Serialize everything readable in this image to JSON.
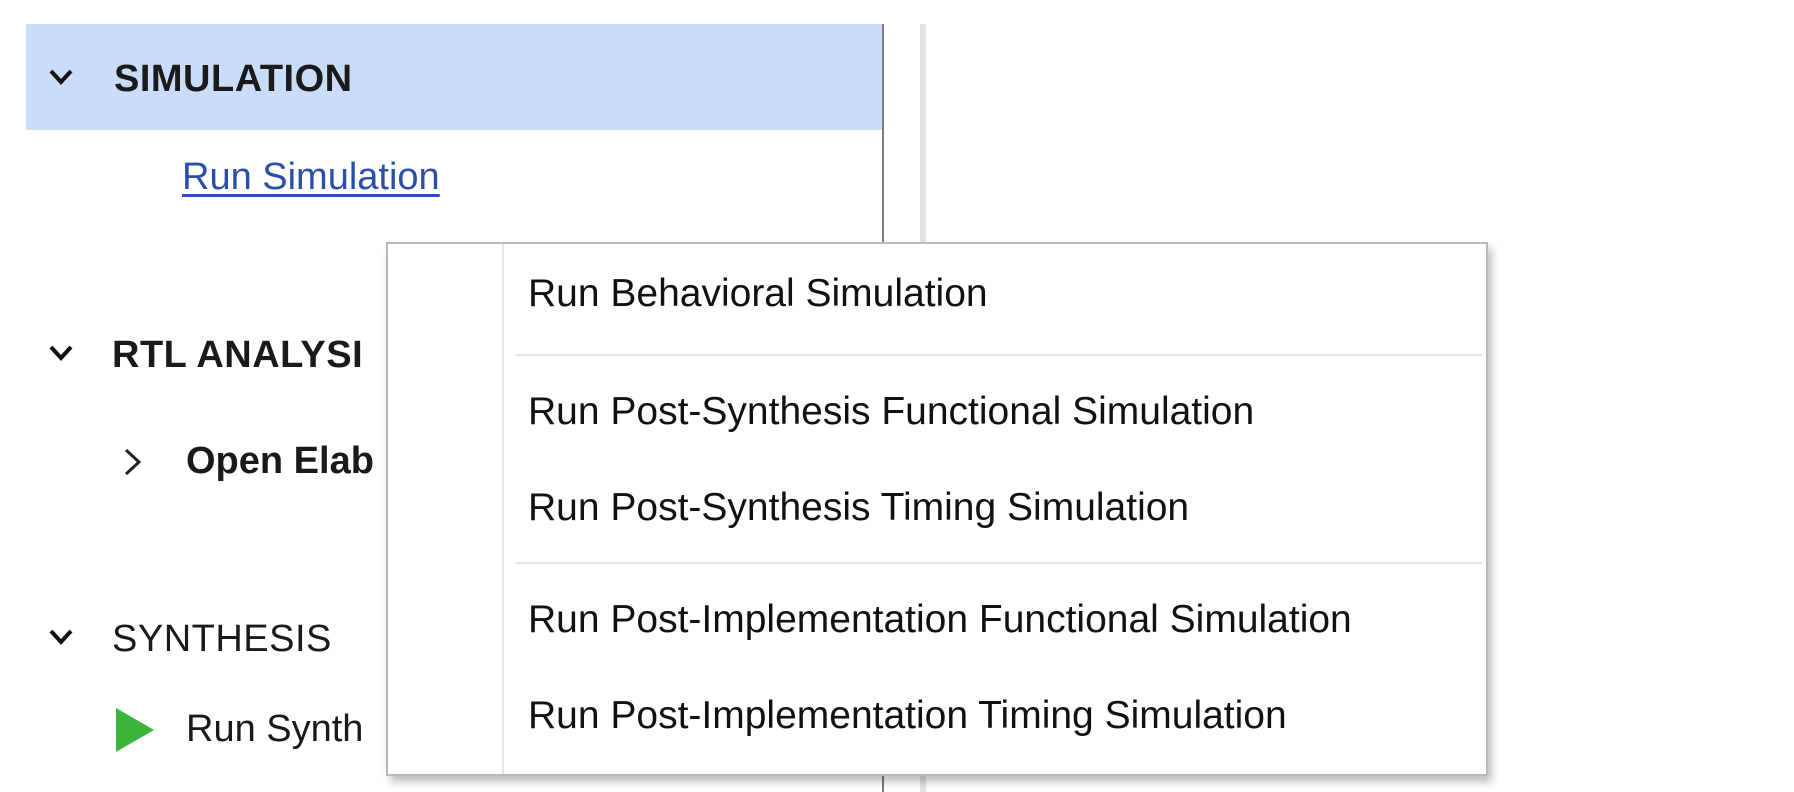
{
  "flow_navigator": {
    "sections": [
      {
        "title": "SIMULATION",
        "expanded": true,
        "selected": true,
        "bold": true,
        "tasks": [
          {
            "label": "Run Simulation",
            "type": "link"
          }
        ]
      },
      {
        "title": "RTL ANALYSI",
        "expanded": true,
        "selected": false,
        "bold": true,
        "tasks": [
          {
            "label": "Open Elab",
            "type": "expandable"
          }
        ]
      },
      {
        "title": "SYNTHESIS",
        "expanded": true,
        "selected": false,
        "bold": false,
        "tasks": [
          {
            "label": "Run Synth",
            "type": "run",
            "icon": "play-icon"
          }
        ]
      }
    ]
  },
  "context_menu": {
    "items": [
      {
        "label": "Run Behavioral Simulation"
      },
      {
        "label": "Run Post-Synthesis Functional Simulation"
      },
      {
        "label": "Run Post-Synthesis Timing Simulation"
      },
      {
        "label": "Run Post-Implementation Functional Simulation"
      },
      {
        "label": "Run Post-Implementation Timing Simulation"
      }
    ]
  },
  "colors": {
    "selected_row": "#c9ddfa",
    "link": "#2b4ea8",
    "run_icon": "#3cb43c"
  }
}
